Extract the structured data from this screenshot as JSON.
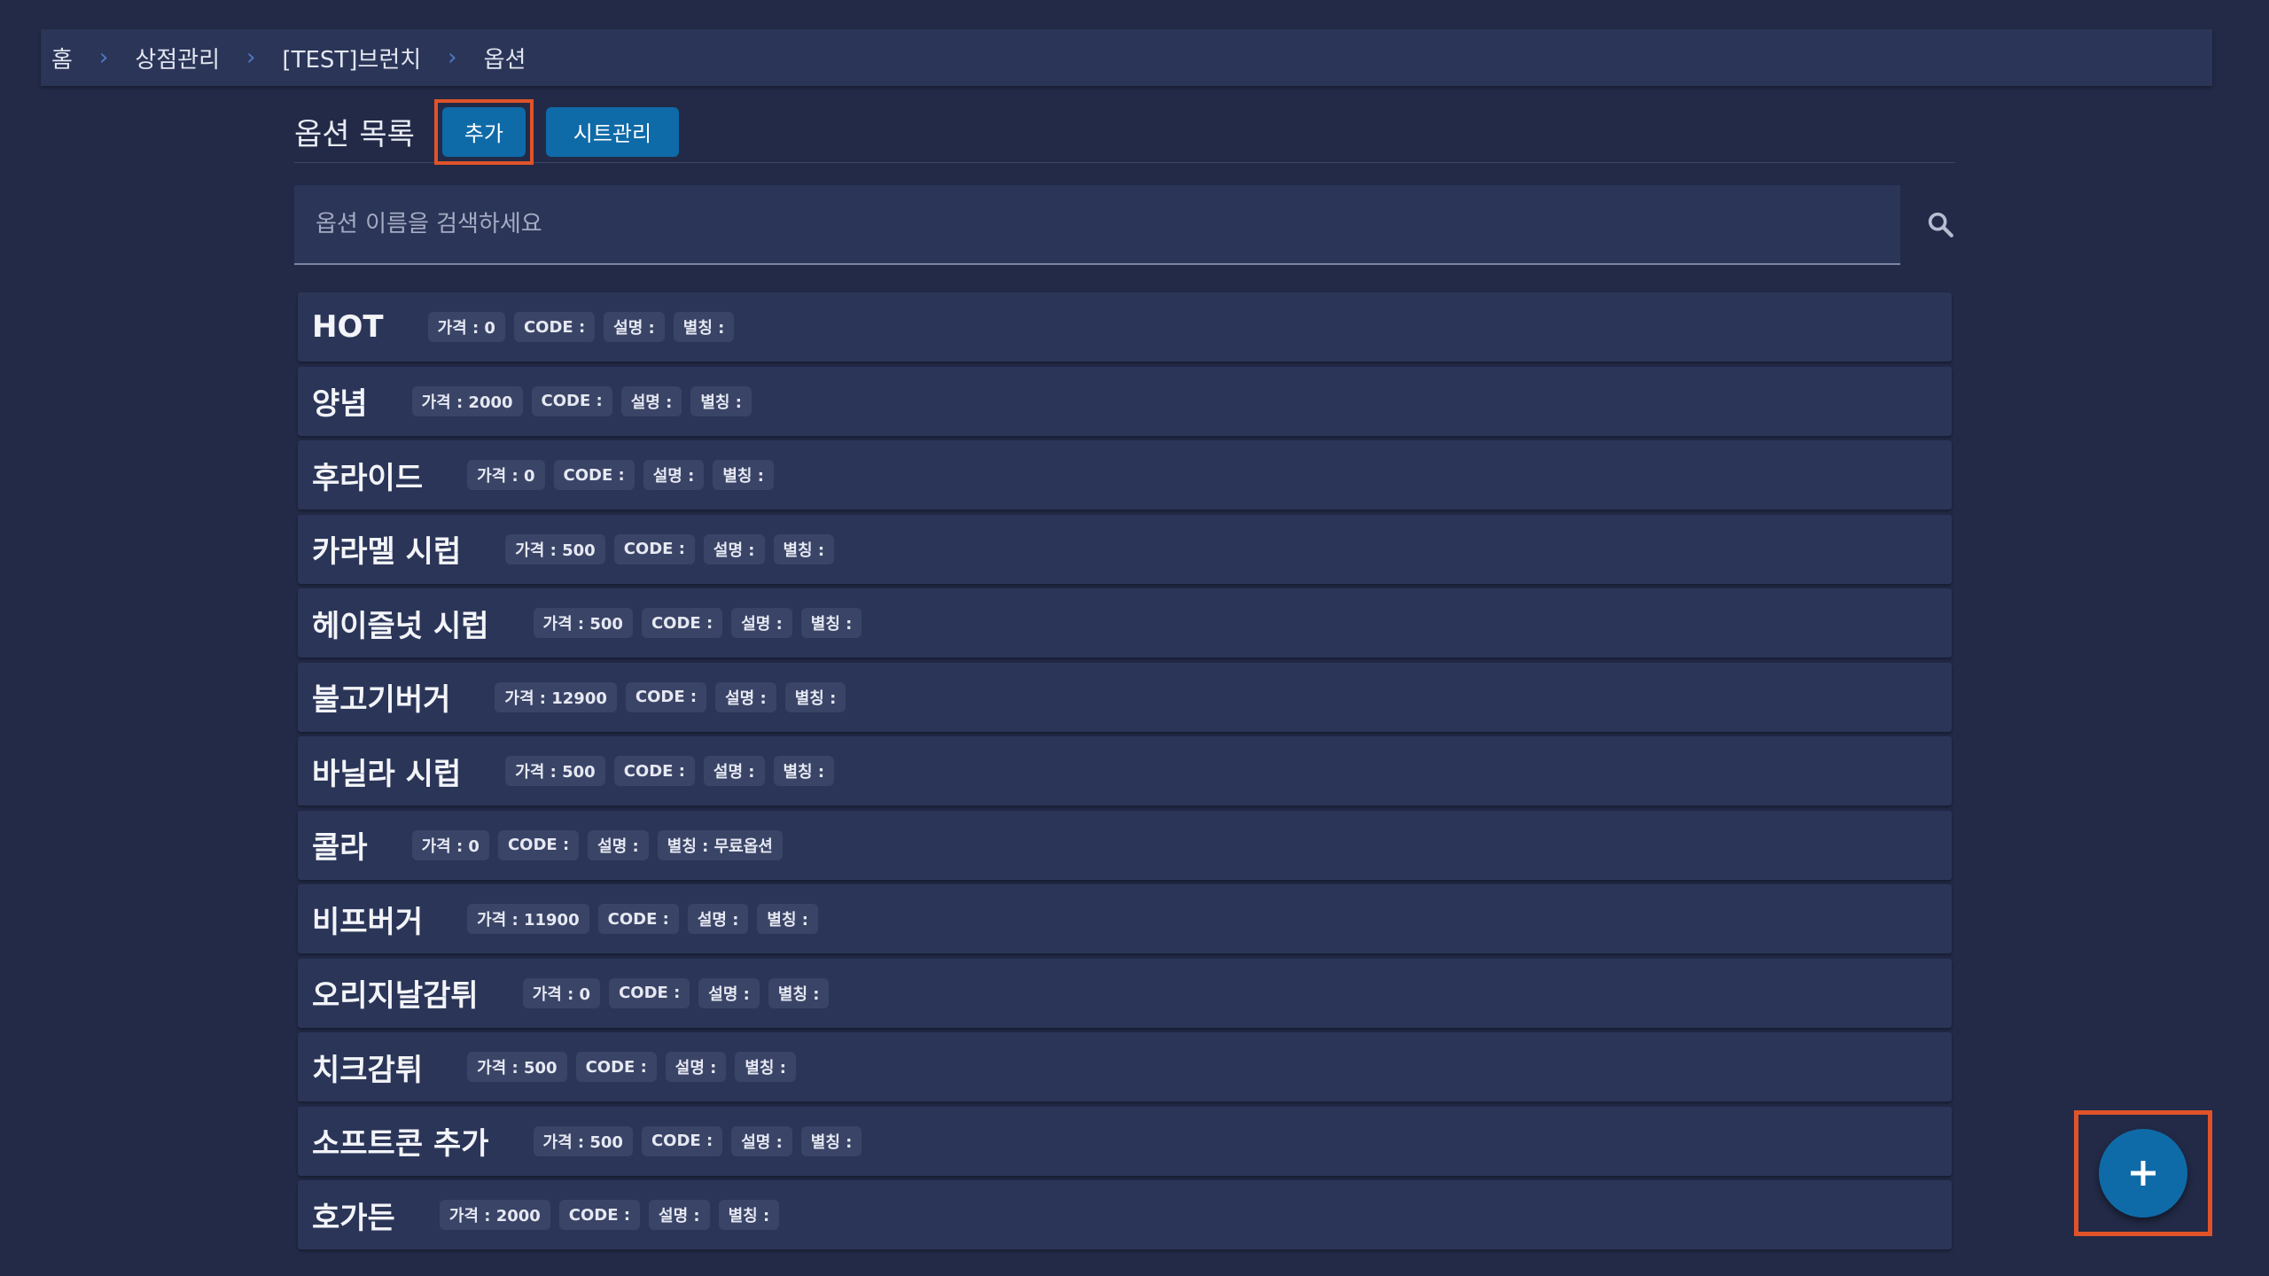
{
  "breadcrumb": [
    {
      "label": "홈"
    },
    {
      "label": "상점관리"
    },
    {
      "label": "[TEST]브런치"
    },
    {
      "label": "옵션"
    }
  ],
  "header": {
    "title": "옵션 목록",
    "add_label": "추가",
    "sheet_label": "시트관리"
  },
  "search": {
    "placeholder": "옵션 이름을 검색하세요",
    "value": ""
  },
  "fab": {
    "label": "+"
  },
  "options": [
    {
      "name": "HOT",
      "price": "가격 : 0",
      "code": "CODE :",
      "desc": "설명 :",
      "nick": "별칭 :"
    },
    {
      "name": "양념",
      "price": "가격 : 2000",
      "code": "CODE :",
      "desc": "설명 :",
      "nick": "별칭 :"
    },
    {
      "name": "후라이드",
      "price": "가격 : 0",
      "code": "CODE :",
      "desc": "설명 :",
      "nick": "별칭 :"
    },
    {
      "name": "카라멜 시럽",
      "price": "가격 : 500",
      "code": "CODE :",
      "desc": "설명 :",
      "nick": "별칭 :"
    },
    {
      "name": "헤이즐넛 시럽",
      "price": "가격 : 500",
      "code": "CODE :",
      "desc": "설명 :",
      "nick": "별칭 :"
    },
    {
      "name": "불고기버거",
      "price": "가격 : 12900",
      "code": "CODE :",
      "desc": "설명 :",
      "nick": "별칭 :"
    },
    {
      "name": "바닐라 시럽",
      "price": "가격 : 500",
      "code": "CODE :",
      "desc": "설명 :",
      "nick": "별칭 :"
    },
    {
      "name": "콜라",
      "price": "가격 : 0",
      "code": "CODE :",
      "desc": "설명 :",
      "nick": "별칭 : 무료옵션"
    },
    {
      "name": "비프버거",
      "price": "가격 : 11900",
      "code": "CODE :",
      "desc": "설명 :",
      "nick": "별칭 :"
    },
    {
      "name": "오리지날감튀",
      "price": "가격 : 0",
      "code": "CODE :",
      "desc": "설명 :",
      "nick": "별칭 :"
    },
    {
      "name": "치크감튀",
      "price": "가격 : 500",
      "code": "CODE :",
      "desc": "설명 :",
      "nick": "별칭 :"
    },
    {
      "name": "소프트콘 추가",
      "price": "가격 : 500",
      "code": "CODE :",
      "desc": "설명 :",
      "nick": "별칭 :"
    },
    {
      "name": "호가든",
      "price": "가격 : 2000",
      "code": "CODE :",
      "desc": "설명 :",
      "nick": "별칭 :"
    }
  ],
  "colors": {
    "background": "#222a47",
    "panel": "#2b3558",
    "accent": "#0f6aa8",
    "highlight": "#e0532a",
    "chip": "#3a4467"
  },
  "icons": {
    "search": "search-icon",
    "breadcrumb_separator": "chevron-right-icon",
    "fab": "plus-icon"
  }
}
